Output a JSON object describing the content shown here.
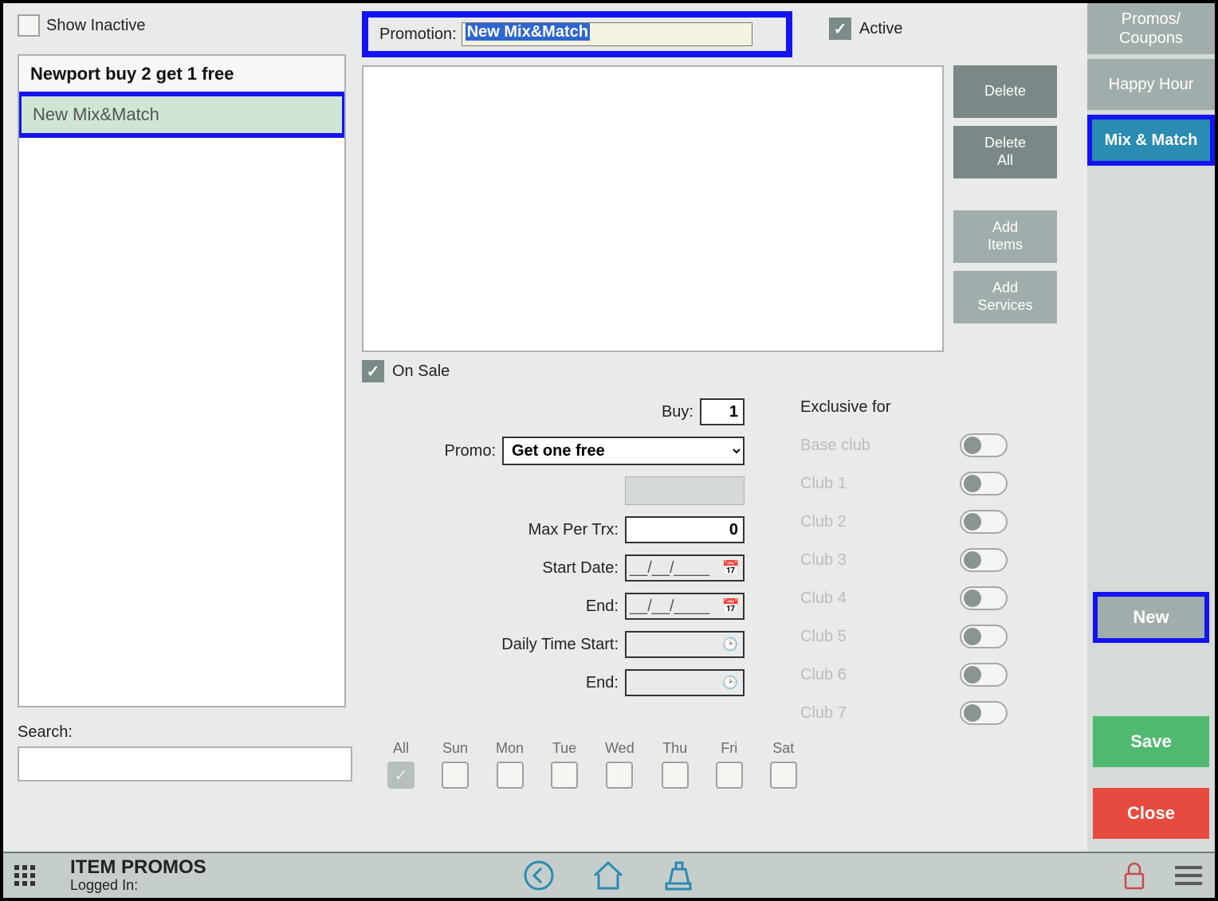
{
  "left": {
    "show_inactive_label": "Show Inactive",
    "list": [
      {
        "label": "Newport buy 2 get 1 free",
        "style": "bold"
      },
      {
        "label": "New Mix&Match",
        "style": "selected"
      }
    ],
    "search_label": "Search:",
    "search_value": ""
  },
  "center": {
    "promotion_label": "Promotion:",
    "promotion_value": "New Mix&Match",
    "active_label": "Active",
    "buttons": {
      "delete": "Delete",
      "delete_all": "Delete\nAll",
      "add_items": "Add\nItems",
      "add_services": "Add\nServices"
    },
    "on_sale_label": "On Sale",
    "fields": {
      "buy_label": "Buy:",
      "buy_value": "1",
      "promo_label": "Promo:",
      "promo_value": "Get one free",
      "max_label": "Max Per Trx:",
      "max_value": "0",
      "start_date_label": "Start Date:",
      "start_date_value": "__/__/____",
      "end_date_label": "End:",
      "end_date_value": "__/__/____",
      "time_start_label": "Daily Time Start:",
      "time_start_value": "",
      "time_end_label": "End:",
      "time_end_value": ""
    },
    "exclusive": {
      "title": "Exclusive for",
      "clubs": [
        "Base club",
        "Club 1",
        "Club 2",
        "Club 3",
        "Club 4",
        "Club 5",
        "Club 6",
        "Club 7"
      ]
    },
    "days": {
      "all": "All",
      "sun": "Sun",
      "mon": "Mon",
      "tue": "Tue",
      "wed": "Wed",
      "thu": "Thu",
      "fri": "Fri",
      "sat": "Sat"
    }
  },
  "right": {
    "tabs": {
      "promos": "Promos/\nCoupons",
      "happy": "Happy Hour",
      "mix": "Mix & Match"
    },
    "new": "New",
    "save": "Save",
    "close": "Close"
  },
  "footer": {
    "title": "ITEM PROMOS",
    "sub": "Logged In:"
  }
}
